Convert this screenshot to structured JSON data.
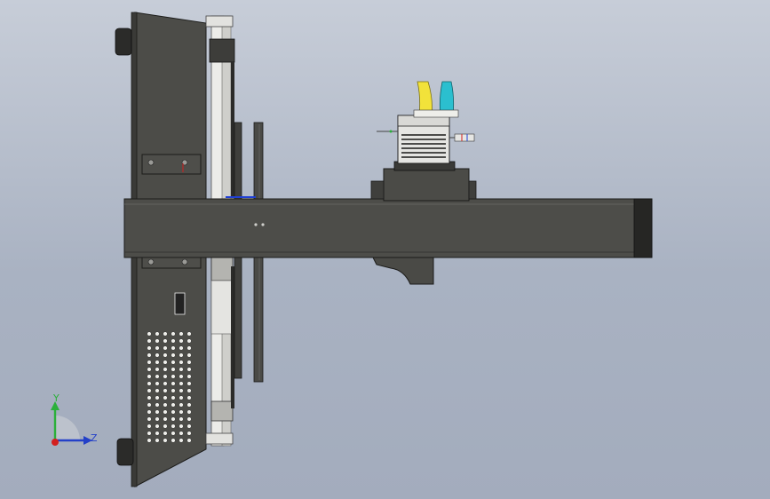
{
  "viewport": {
    "background_top": "#c7cdd8",
    "background_bottom": "#a3acbd"
  },
  "model": {
    "body_color": "#4a4a46",
    "rail_color": "#e8e8e6",
    "cable_colors": [
      "#f2e23a",
      "#2bbfcf"
    ]
  },
  "triad": {
    "y_label": "Y",
    "z_label": "Z",
    "y_color": "#2bb03a",
    "z_color": "#2340c8",
    "origin_color": "#d21f1f"
  }
}
